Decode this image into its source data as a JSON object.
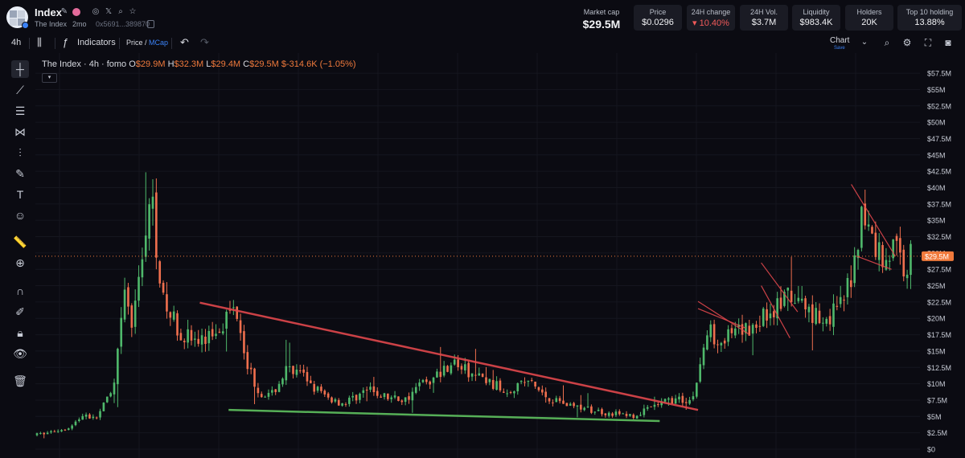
{
  "header": {
    "token_name": "Index",
    "token_fullname": "The Index",
    "age": "2mo",
    "address": "0x5691...389870",
    "stats": [
      {
        "label": "Market cap",
        "value": "$29.5M",
        "style": "big"
      },
      {
        "label": "Price",
        "value": "$0.0296",
        "style": "box"
      },
      {
        "label": "24H change",
        "value": "▾ 10.40%",
        "style": "box-neg"
      },
      {
        "label": "24H Vol.",
        "value": "$3.7M",
        "style": "box"
      },
      {
        "label": "Liquidity",
        "value": "$983.4K",
        "style": "box"
      },
      {
        "label": "Holders",
        "value": "20K",
        "style": "box"
      },
      {
        "label": "Top 10 holding",
        "value": "13.88%",
        "style": "box"
      }
    ]
  },
  "toolbar": {
    "interval": "4h",
    "indicators_label": "Indicators",
    "price_label": "Price",
    "mcap_label": "MCap",
    "chart_label": "Chart",
    "save_label": "Save"
  },
  "legend": {
    "title": "The Index · 4h · fomo",
    "o_label": "O",
    "o_value": "$29.9M",
    "h_label": "H",
    "h_value": "$32.3M",
    "l_label": "L",
    "l_value": "$29.4M",
    "c_label": "C",
    "c_value": "$29.5M",
    "change": "$-314.6K (−1.05%)"
  },
  "colors": {
    "up": "#4fb86b",
    "down": "#ef6f4e",
    "accent": "#3b82f6",
    "resistance": "#e0474c",
    "support": "#5fc15f",
    "current_price": "#f07a3c"
  },
  "chart_data": {
    "type": "candlestick",
    "title": "The Index · 4h · fomo",
    "y_unit": "$M",
    "ylim": [
      0,
      58
    ],
    "y_ticks": [
      "$0",
      "$2.5M",
      "$5M",
      "$7.5M",
      "$10M",
      "$12.5M",
      "$15M",
      "$17.5M",
      "$20M",
      "$22.5M",
      "$25M",
      "$27.5M",
      "$30M",
      "$32.5M",
      "$35M",
      "$37.5M",
      "$40M",
      "$42.5M",
      "$45M",
      "$47.5M",
      "$50M",
      "$52.5M",
      "$55M",
      "$57.5M"
    ],
    "y_tick_values": [
      0,
      2.5,
      5,
      7.5,
      10,
      12.5,
      15,
      17.5,
      20,
      22.5,
      25,
      27.5,
      30,
      32.5,
      35,
      37.5,
      40,
      42.5,
      45,
      47.5,
      50,
      52.5,
      55,
      57.5
    ],
    "current_price_label": "$29.5M",
    "current_price": 29.5,
    "candle_count": 250,
    "anchors": [
      [
        0,
        2.2
      ],
      [
        10,
        2.8
      ],
      [
        18,
        3.5
      ],
      [
        25,
        5.5
      ],
      [
        30,
        4.5
      ],
      [
        40,
        9
      ],
      [
        46,
        24
      ],
      [
        50,
        18
      ],
      [
        55,
        31
      ],
      [
        60,
        38
      ],
      [
        66,
        22
      ],
      [
        75,
        18
      ],
      [
        85,
        16
      ],
      [
        95,
        19
      ],
      [
        104,
        22
      ],
      [
        110,
        13
      ],
      [
        115,
        9
      ],
      [
        122,
        8
      ],
      [
        130,
        12
      ],
      [
        140,
        11
      ],
      [
        150,
        8
      ],
      [
        160,
        7
      ],
      [
        172,
        9
      ],
      [
        182,
        8
      ],
      [
        192,
        7.5
      ],
      [
        200,
        10
      ],
      [
        208,
        11
      ],
      [
        216,
        13.5
      ],
      [
        226,
        11.5
      ],
      [
        234,
        10.5
      ],
      [
        244,
        9
      ],
      [
        256,
        10.5
      ],
      [
        266,
        8
      ],
      [
        276,
        7
      ],
      [
        288,
        6
      ],
      [
        300,
        5.5
      ],
      [
        312,
        5
      ],
      [
        322,
        6.5
      ],
      [
        330,
        7.5
      ],
      [
        342,
        7.5
      ],
      [
        350,
        18
      ],
      [
        358,
        17
      ],
      [
        366,
        17.5
      ],
      [
        374,
        19
      ],
      [
        382,
        21
      ],
      [
        392,
        23
      ],
      [
        400,
        22
      ],
      [
        410,
        20
      ],
      [
        418,
        21
      ],
      [
        424,
        25
      ],
      [
        430,
        36
      ],
      [
        436,
        32
      ],
      [
        442,
        29
      ],
      [
        448,
        31
      ],
      [
        452,
        28
      ],
      [
        456,
        29.5
      ]
    ],
    "trendlines": [
      {
        "name": "resistance",
        "x": [
          85,
          345
        ],
        "y": [
          22.4,
          6
        ]
      },
      {
        "name": "support",
        "x": [
          100,
          325
        ],
        "y": [
          6,
          4.3
        ]
      },
      {
        "name": "wedge1-upper",
        "x": [
          345,
          372
        ],
        "y": [
          22.6,
          17.5
        ]
      },
      {
        "name": "wedge1-lower",
        "x": [
          345,
          370
        ],
        "y": [
          21.5,
          18.5
        ]
      },
      {
        "name": "wedge2-upper",
        "x": [
          378,
          397
        ],
        "y": [
          28.5,
          21
        ]
      },
      {
        "name": "wedge2-lower",
        "x": [
          378,
          393
        ],
        "y": [
          25,
          17
        ]
      },
      {
        "name": "flag-upper",
        "x": [
          425,
          448
        ],
        "y": [
          40.5,
          29.5
        ]
      },
      {
        "name": "flag-lower",
        "x": [
          428,
          446
        ],
        "y": [
          29.5,
          27.5
        ]
      }
    ]
  }
}
